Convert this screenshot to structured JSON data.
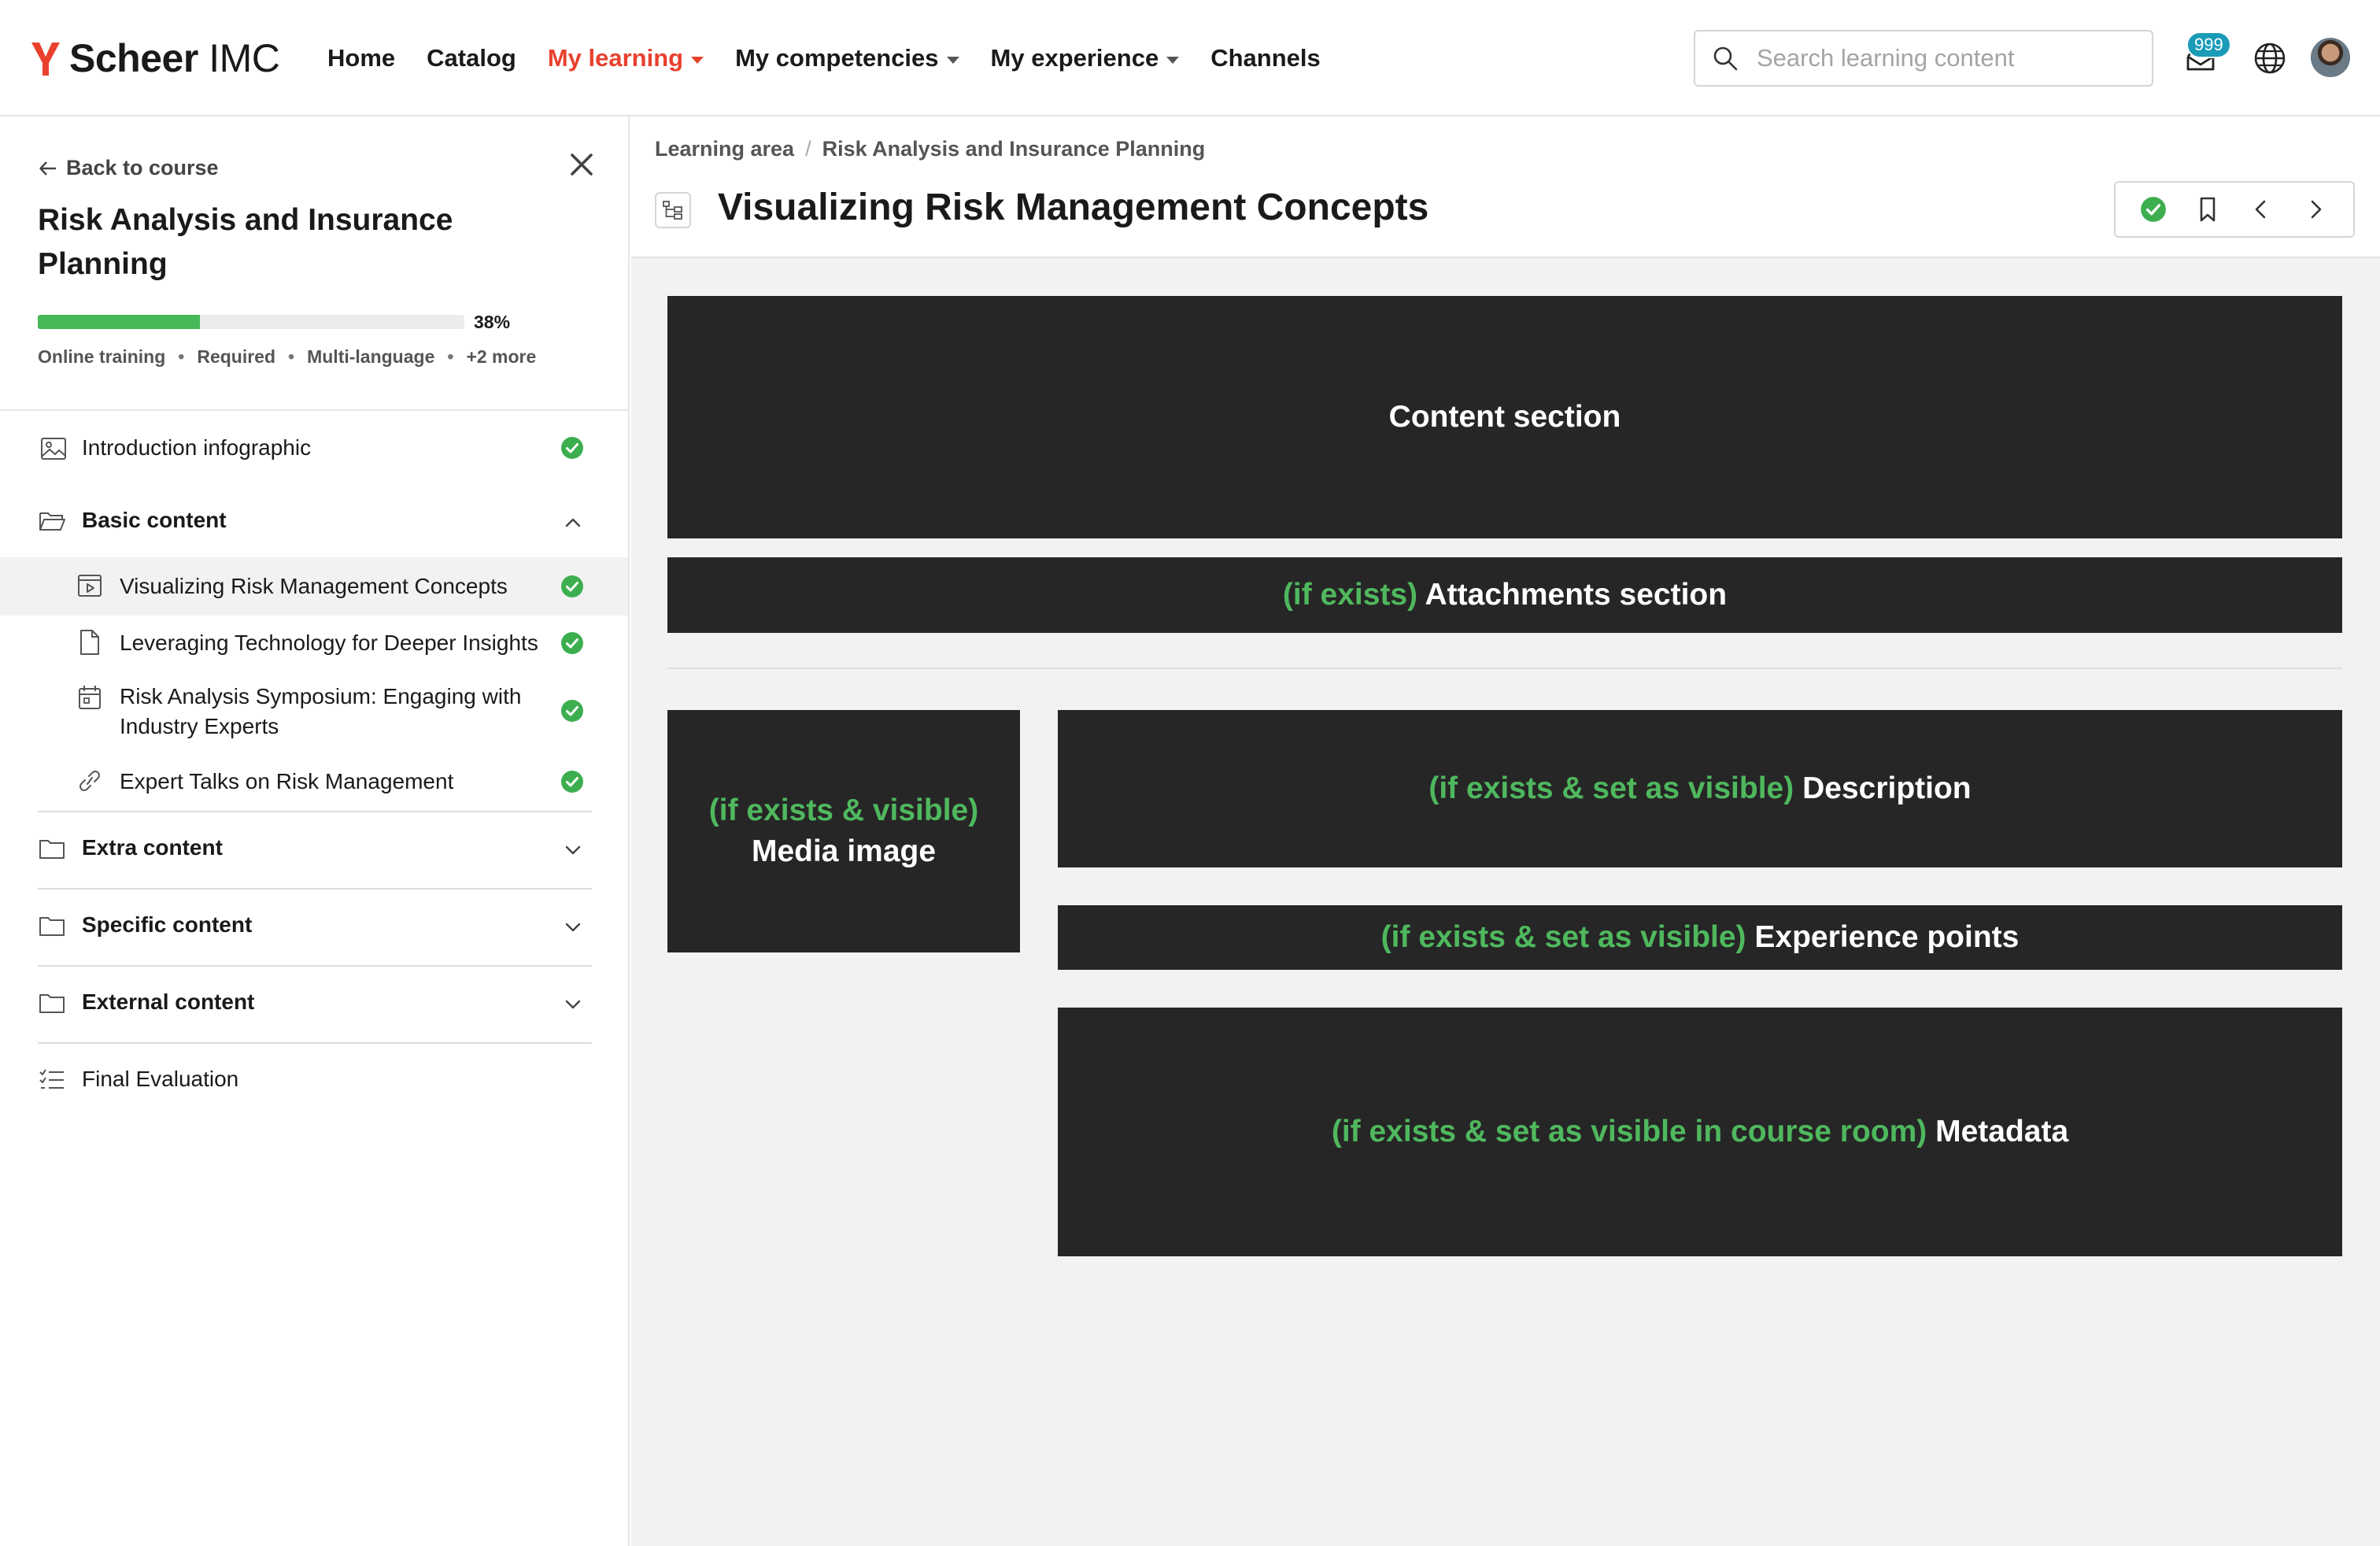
{
  "header": {
    "logo": {
      "brand": "Scheer",
      "suffix": "IMC",
      "color": "#e8412e"
    },
    "nav": [
      {
        "label": "Home",
        "active": false,
        "dropdown": false
      },
      {
        "label": "Catalog",
        "active": false,
        "dropdown": false
      },
      {
        "label": "My learning",
        "active": true,
        "dropdown": true
      },
      {
        "label": "My competencies",
        "active": false,
        "dropdown": true
      },
      {
        "label": "My experience",
        "active": false,
        "dropdown": true
      },
      {
        "label": "Channels",
        "active": false,
        "dropdown": false
      }
    ],
    "search": {
      "placeholder": "Search learning content",
      "value": ""
    },
    "inbox_badge": "999",
    "icons": [
      "search-icon",
      "inbox-icon",
      "globe-icon",
      "avatar"
    ]
  },
  "sidebar": {
    "back_label": "Back to course",
    "course_title": "Risk Analysis and Insurance Planning",
    "progress": {
      "value": 38,
      "label": "38%",
      "color": "#46b858"
    },
    "meta": [
      "Online training",
      "Required",
      "Multi-language",
      "+2 more"
    ],
    "items": [
      {
        "label": "Introduction infographic",
        "icon": "image-icon",
        "completed": true
      },
      {
        "label": "Basic content",
        "icon": "folder-open-icon",
        "folder": true,
        "expanded": true,
        "children": [
          {
            "label": "Visualizing Risk Management Concepts",
            "icon": "media-icon",
            "completed": true,
            "selected": true
          },
          {
            "label": "Leveraging Technology for Deeper Insights",
            "icon": "document-icon",
            "completed": true
          },
          {
            "label": "Risk Analysis Symposium: Engaging with Industry Experts",
            "icon": "calendar-icon",
            "completed": true
          },
          {
            "label": "Expert Talks on Risk Management",
            "icon": "link-icon",
            "completed": true
          }
        ]
      },
      {
        "label": "Extra content",
        "icon": "folder-icon",
        "folder": true,
        "expanded": false
      },
      {
        "label": "Specific content",
        "icon": "folder-icon",
        "folder": true,
        "expanded": false
      },
      {
        "label": "External content",
        "icon": "folder-icon",
        "folder": true,
        "expanded": false
      },
      {
        "label": "Final Evaluation",
        "icon": "checklist-icon",
        "completed": false
      }
    ]
  },
  "main": {
    "breadcrumb": [
      "Learning area",
      "Risk Analysis and Insurance Planning"
    ],
    "title": "Visualizing Risk Management Concepts",
    "toolbar": [
      "complete-check-icon",
      "bookmark-icon",
      "chevron-left-icon",
      "chevron-right-icon"
    ],
    "blocks": {
      "content": {
        "label": "Content section"
      },
      "attachments": {
        "cond": "(if exists)",
        "label": "Attachments section"
      },
      "media": {
        "cond": "(if exists & visible)",
        "label": "Media image"
      },
      "description": {
        "cond": "(if exists & set as visible)",
        "label": "Description"
      },
      "experience": {
        "cond": "(if exists & set as visible)",
        "label": "Experience points"
      },
      "metadata": {
        "cond": "(if exists & set as visible in course room)",
        "label": "Metadata"
      }
    },
    "colors": {
      "block_bg": "#262626",
      "condition_text": "#4fb85e",
      "page_bg": "#f2f2f2"
    }
  }
}
